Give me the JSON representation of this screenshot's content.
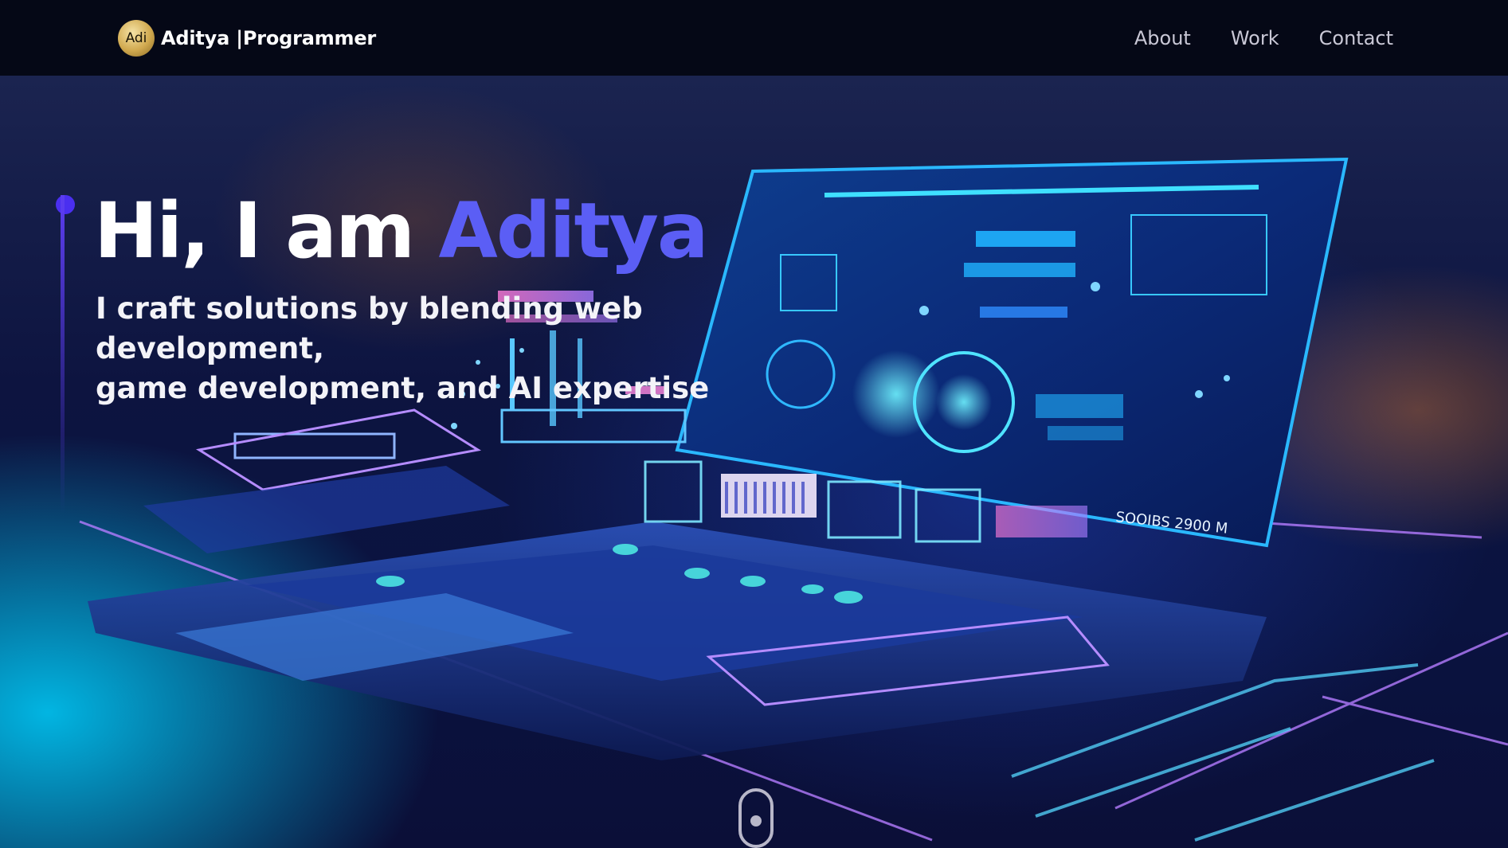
{
  "brand": {
    "logo_text": "Adi",
    "title": "Aditya |Programmer"
  },
  "nav": {
    "items": [
      {
        "label": "About"
      },
      {
        "label": "Work"
      },
      {
        "label": "Contact"
      }
    ]
  },
  "hero": {
    "greeting": "Hi, I am ",
    "name": "Aditya",
    "subtitle_line1": "I craft solutions by blending web development,",
    "subtitle_line2": "game development, and AI expertise",
    "screen_text": "SOOIBS 2900 M"
  },
  "colors": {
    "accent": "#5b5ef5",
    "background": "#050816",
    "nav_text": "#c9c8d6"
  },
  "icons": {
    "scroll": "mouse-scroll-icon",
    "logo": "logo-badge"
  }
}
